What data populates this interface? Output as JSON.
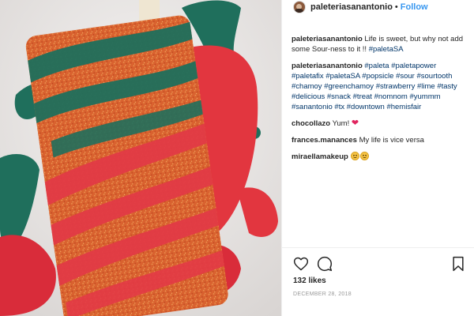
{
  "header": {
    "username": "paleteriasanantonio",
    "separator": "•",
    "follow_label": "Follow"
  },
  "caption": {
    "username": "paleteriasanantonio",
    "text": "Life is sweet, but why not add some Sour-ness to it !! ",
    "hashtag": "#paletaSA"
  },
  "hashtag_comment": {
    "username": "paleteriasanantonio",
    "tags": [
      "#paleta",
      "#paletapower",
      "#paletafix",
      "#paletaSA",
      "#popsicle",
      "#sour",
      "#sourtooth",
      "#chamoy",
      "#greenchamoy",
      "#strawberry",
      "#lime",
      "#tasty",
      "#delicious",
      "#snack",
      "#treat",
      "#nomnom",
      "#yummm",
      "#sanantonio",
      "#tx",
      "#downtown",
      "#hemisfair"
    ]
  },
  "comments": [
    {
      "username": "chocollazo",
      "text": "Yum!",
      "icon": "red-heart-icon"
    },
    {
      "username": "frances.manances",
      "text": "My life is vice versa"
    },
    {
      "username": "miraellamakeup",
      "text": "",
      "icon": "grinning-sweat-emoji-icon x2"
    }
  ],
  "actions": {
    "like": "heart-outline-icon",
    "comment": "speech-bubble-icon",
    "save": "bookmark-icon"
  },
  "likes_text": "132 likes",
  "date_text": "DECEMBER 28, 2018",
  "colors": {
    "link": "#003569",
    "follow": "#3897f0",
    "heart": "#e0245e",
    "meta": "#999999"
  }
}
